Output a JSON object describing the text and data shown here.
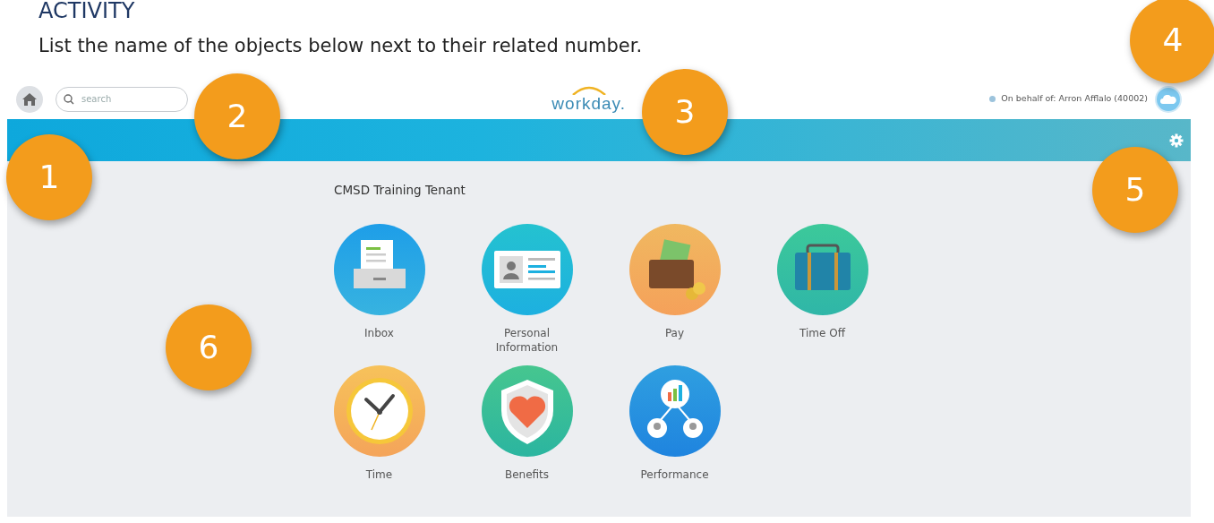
{
  "worksheet": {
    "heading": "ACTIVITY",
    "instruction": "List the name of the objects below next to their related number."
  },
  "app": {
    "search": {
      "placeholder": "search"
    },
    "logo": "workday.",
    "proxy": "On behalf of: Arron Afflalo (40002)",
    "tenant": "CMSD Training Tenant",
    "apps": [
      {
        "label": "Inbox",
        "kind": "inbox"
      },
      {
        "label": "Personal Information",
        "kind": "id"
      },
      {
        "label": "Pay",
        "kind": "pay"
      },
      {
        "label": "Time Off",
        "kind": "suitcase"
      },
      {
        "label": "Time",
        "kind": "clock"
      },
      {
        "label": "Benefits",
        "kind": "shield"
      },
      {
        "label": "Performance",
        "kind": "chart"
      }
    ]
  },
  "markers": [
    {
      "label": "1",
      "kind": "home"
    },
    {
      "label": "2",
      "kind": "search"
    },
    {
      "label": "3",
      "kind": "logo"
    },
    {
      "label": "4",
      "kind": "profile"
    },
    {
      "label": "5",
      "kind": "settings"
    },
    {
      "label": "6",
      "kind": "apps"
    }
  ]
}
